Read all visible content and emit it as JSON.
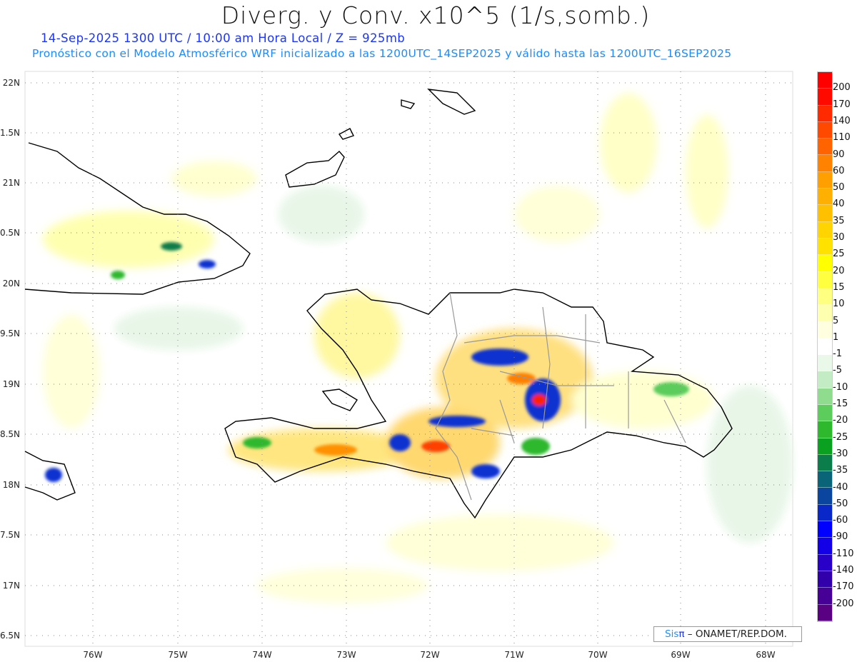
{
  "header": {
    "title": "Diverg. y Conv. x10^5 (1/s,somb.)",
    "subtitle": "14-Sep-2025  1300 UTC / 10:00 am Hora Local / Z = 925mb",
    "subtitle2": "Pronóstico con el Modelo Atmosférico WRF inicializado a las 1200UTC_14SEP2025 y válido hasta las  1200UTC_16SEP2025"
  },
  "axes": {
    "lon_labels": [
      "76W",
      "75W",
      "74W",
      "73W",
      "72W",
      "71W",
      "70W",
      "69W",
      "68W"
    ],
    "lat_labels": [
      "22N",
      "1.5N",
      "21N",
      "0.5N",
      "20N",
      "9.5N",
      "19N",
      "8.5N",
      "18N",
      "7.5N",
      "17N",
      "6.5N"
    ]
  },
  "colorbar": {
    "labels": [
      "200",
      "170",
      "140",
      "110",
      "90",
      "60",
      "50",
      "40",
      "35",
      "30",
      "25",
      "20",
      "15",
      "10",
      "5",
      "1",
      "-1",
      "-5",
      "-10",
      "-15",
      "-20",
      "-25",
      "-30",
      "-35",
      "-40",
      "-50",
      "-60",
      "-90",
      "-110",
      "-140",
      "-170",
      "-200"
    ],
    "colors": [
      "#ff0000",
      "#ff0a00",
      "#ff2a00",
      "#ff4800",
      "#ff6400",
      "#ff8200",
      "#ffa000",
      "#ffb000",
      "#ffc000",
      "#ffd400",
      "#ffe200",
      "#ffff00",
      "#ffff40",
      "#ffff80",
      "#ffffb0",
      "#ffffe0",
      "#ffffff",
      "#eaf8ea",
      "#c4ecc4",
      "#8fdc8f",
      "#5ccc5c",
      "#2eb82e",
      "#0aa020",
      "#0a7d4a",
      "#0a6478",
      "#0a46a0",
      "#0a28c8",
      "#0000ff",
      "#1400e6",
      "#2800c8",
      "#3200aa",
      "#460096",
      "#5a0082"
    ]
  },
  "credit": {
    "sis": "Sis",
    "pi": "π",
    "text": " –  ONAMET/REP.DOM."
  }
}
